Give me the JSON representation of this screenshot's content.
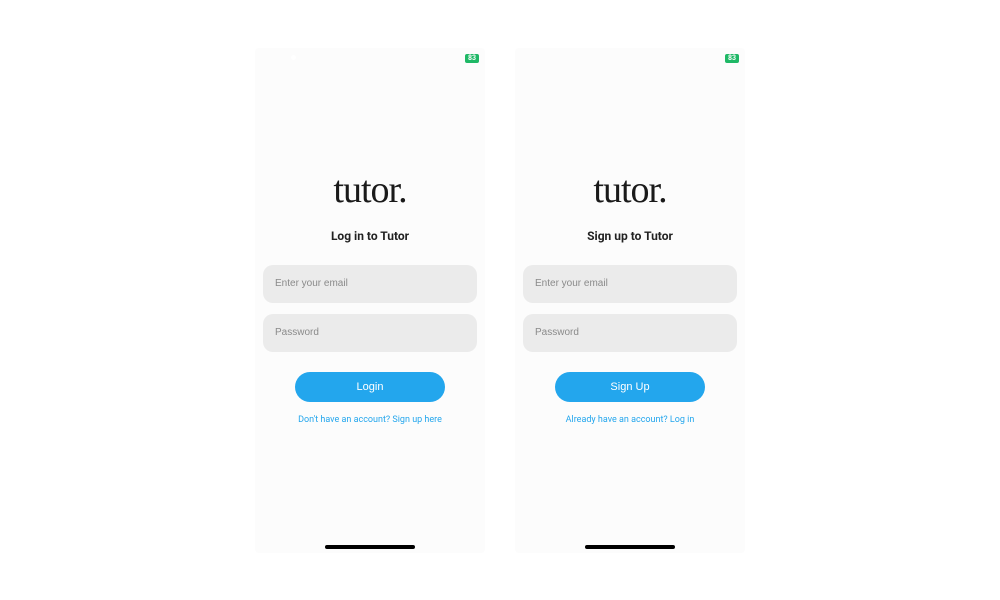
{
  "status": {
    "battery": "83"
  },
  "login": {
    "logo": "tutor.",
    "subtitle": "Log in to Tutor",
    "email_placeholder": "Enter your email",
    "password_placeholder": "Password",
    "button": "Login",
    "alt_link": "Don't have an account? Sign up here"
  },
  "signup": {
    "logo": "tutor.",
    "subtitle": "Sign up to Tutor",
    "email_placeholder": "Enter your email",
    "password_placeholder": "Password",
    "button": "Sign Up",
    "alt_link": "Already have an account? Log in"
  },
  "colors": {
    "primary": "#23a6ed",
    "input_bg": "#ebebeb",
    "badge": "#1fb866"
  }
}
